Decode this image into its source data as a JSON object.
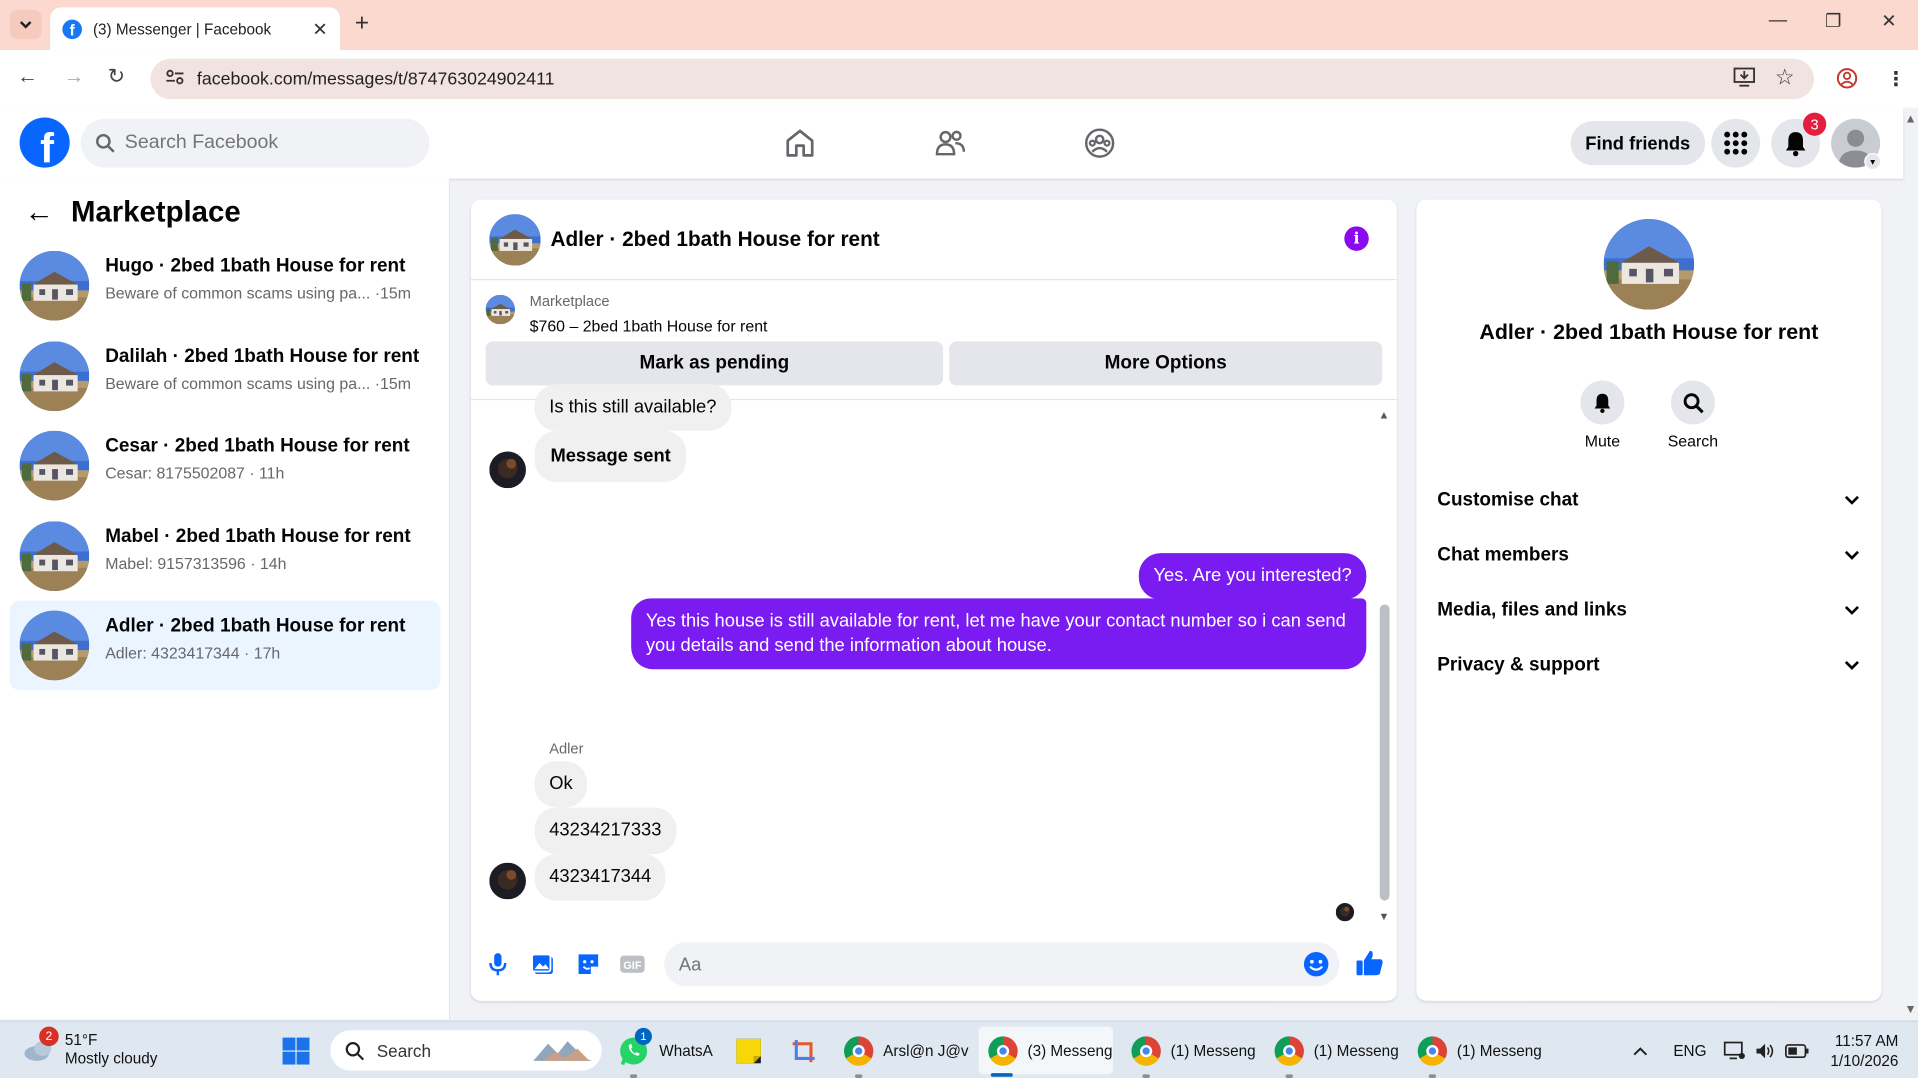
{
  "browser": {
    "tab_title": "(3) Messenger | Facebook",
    "url": "facebook.com/messages/t/874763024902411"
  },
  "header": {
    "search_placeholder": "Search Facebook",
    "find_friends": "Find friends",
    "notification_count": "3"
  },
  "sidebar": {
    "title": "Marketplace",
    "conversations": [
      {
        "name": "Hugo · 2bed 1bath House for rent",
        "preview": "Beware of common scams using pa... ·15m",
        "active": false
      },
      {
        "name": "Dalilah · 2bed 1bath House for rent",
        "preview": "Beware of common scams using pa... ·15m",
        "active": false
      },
      {
        "name": "Cesar · 2bed 1bath House for rent",
        "preview": "Cesar: 8175502087 · 11h",
        "active": false
      },
      {
        "name": "Mabel · 2bed 1bath House for rent",
        "preview": "Mabel: 9157313596 · 14h",
        "active": false
      },
      {
        "name": "Adler · 2bed 1bath House for rent",
        "preview": "Adler: 4323417344 · 17h",
        "active": true
      }
    ]
  },
  "chat": {
    "title": "Adler · 2bed 1bath House for rent",
    "marketplace_label": "Marketplace",
    "listing": "$760 – 2bed 1bath House for rent",
    "mark_pending": "Mark as pending",
    "more_options": "More Options",
    "messages": [
      {
        "dir": "in",
        "text": "Is this still available?"
      },
      {
        "dir": "in",
        "text": "Message sent"
      },
      {
        "dir": "out",
        "text": "Yes. Are you interested?"
      },
      {
        "dir": "out",
        "text": "Yes this house is still available for rent, let me have your contact number so i can send you details and send the information about house."
      },
      {
        "dir": "in",
        "text": "Ok",
        "sender": "Adler"
      },
      {
        "dir": "in",
        "text": "43234217333"
      },
      {
        "dir": "in",
        "text": "4323417344"
      }
    ],
    "composer_placeholder": "Aa"
  },
  "info_panel": {
    "name": "Adler · 2bed 1bath House for rent",
    "actions": [
      "Mute",
      "Search"
    ],
    "sections": [
      "Customise chat",
      "Chat members",
      "Media, files and links",
      "Privacy & support"
    ]
  },
  "taskbar": {
    "weather_temp": "51°F",
    "weather_desc": "Mostly cloudy",
    "weather_badge": "2",
    "search": "Search",
    "whatsapp_label": "WhatsA",
    "whatsapp_badge": "1",
    "chrome_items": [
      "Arsl@n J@v",
      "(3) Messeng",
      "(1) Messeng",
      "(1) Messeng",
      "(1) Messeng"
    ],
    "lang": "ENG",
    "time": "11:57 AM",
    "date": "1/10/2026"
  },
  "colors": {
    "accent": "#7a1bf1",
    "facebook_blue": "#0866ff",
    "tabstrip": "#fbd9cf"
  }
}
